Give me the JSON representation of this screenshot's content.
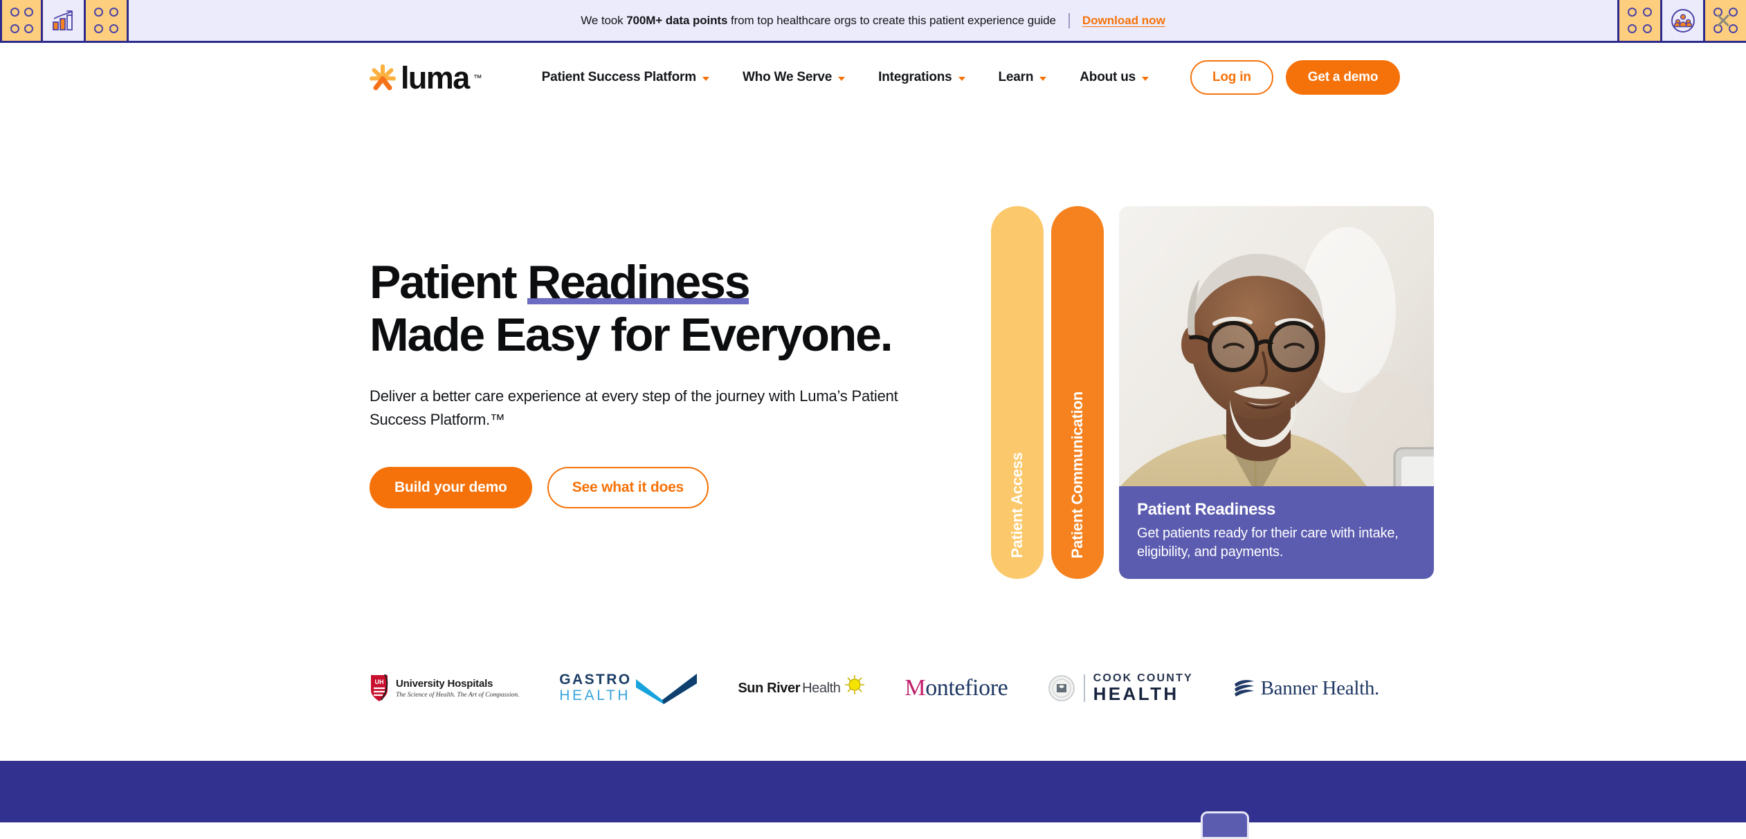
{
  "promo_banner": {
    "text_before": "We took ",
    "highlight": "700M+ data points",
    "text_after": " from top healthcare orgs to create this patient experience guide",
    "link_label": "Download now",
    "close_icon": "close-icon",
    "chart_icon": "bar-chart-growth-icon",
    "people_icon": "people-group-icon",
    "colors": {
      "background": "#ECEBFB",
      "border": "#2E2A8C",
      "tile": "#FCCE7E",
      "link": "#F5720A"
    }
  },
  "header": {
    "logo_text": "luma",
    "logo_tm": "™",
    "logo_icon": "luma-starburst-icon",
    "nav": [
      {
        "label": "Patient Success Platform",
        "has_dropdown": true
      },
      {
        "label": "Who We Serve",
        "has_dropdown": true
      },
      {
        "label": "Integrations",
        "has_dropdown": true
      },
      {
        "label": "Learn",
        "has_dropdown": true
      },
      {
        "label": "About us",
        "has_dropdown": true
      }
    ],
    "login_label": "Log in",
    "demo_label": "Get a demo"
  },
  "hero": {
    "title_line1_plain": "Patient ",
    "title_line1_highlight": "Readiness",
    "title_line2": "Made Easy for Everyone.",
    "underline_color": "#6C6CC2",
    "subtitle": "Deliver a better care experience at every step of the journey with Luma’s Patient Success Platform.™",
    "cta_primary": "Build your demo",
    "cta_secondary": "See what it does",
    "tabs": [
      {
        "label": "Patient Access",
        "color": "#FBC96B"
      },
      {
        "label": "Patient Communication",
        "color": "#F5821F"
      }
    ],
    "card": {
      "title": "Patient Readiness",
      "body": "Get patients ready for their care with intake, eligibility, and payments.",
      "background": "#5B5BB0",
      "photo_alt": "older-man-with-glasses-using-tablet"
    }
  },
  "clients": [
    {
      "name": "University Hospitals",
      "tagline": "The Science of Health. The Art of Compassion."
    },
    {
      "name_line1": "GASTRO",
      "name_line2": "HEALTH"
    },
    {
      "name_bold": "Sun River",
      "name_light": "Health"
    },
    {
      "name": "Montefiore",
      "first_letter": "M",
      "rest": "ontefiore"
    },
    {
      "name_line1": "COOK COUNTY",
      "name_line2": "HEALTH"
    },
    {
      "name": "Banner Health",
      "suffix": "."
    }
  ],
  "bottom_section": {
    "background": "#33318F"
  }
}
